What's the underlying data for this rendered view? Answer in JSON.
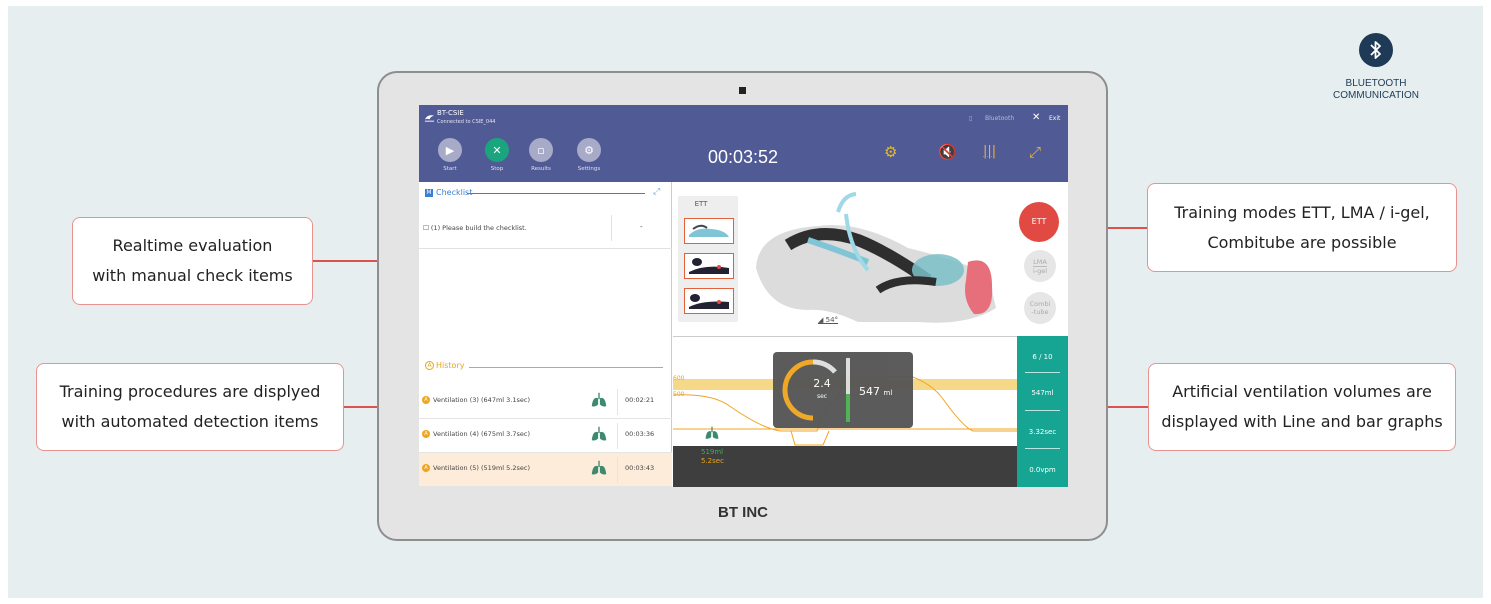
{
  "callouts": {
    "realtime": {
      "line1": "Realtime evaluation",
      "line2": "with manual check items"
    },
    "procedures": {
      "line1": "Training procedures are displyed",
      "line2": "with automated detection items"
    },
    "modes": {
      "line1": "Training modes ETT, LMA / i-gel,",
      "line2": "Combitube are possible"
    },
    "ventilation": {
      "line1": "Artificial ventilation volumes are",
      "line2": "displayed with Line and bar graphs"
    }
  },
  "bluetooth": {
    "icon": "bluetooth-icon",
    "line1": "BLUETOOTH",
    "line2": "COMMUNICATION"
  },
  "device": {
    "brand": "BT INC"
  },
  "app": {
    "title": "BT-CSIE",
    "subtitle": "Connected to CSIE_044",
    "bluetooth_label": "Bluetooth",
    "exit_label": "Exit",
    "timer": "00:03:52",
    "toolbar": [
      {
        "label": "Start",
        "icon": "play-icon"
      },
      {
        "label": "Stop",
        "icon": "close-icon"
      },
      {
        "label": "Results",
        "icon": "document-icon"
      },
      {
        "label": "Settings",
        "icon": "gear-icon"
      }
    ]
  },
  "checklist": {
    "title": "Checklist",
    "items": [
      {
        "text": "(1) Please build the checklist.",
        "value": "-"
      }
    ]
  },
  "history": {
    "title": "History",
    "items": [
      {
        "label": "Ventilation (3)",
        "detail": "(647ml 3.1sec)",
        "time": "00:02:21"
      },
      {
        "label": "Ventilation (4)",
        "detail": "(675ml 3.7sec)",
        "time": "00:03:36"
      },
      {
        "label": "Ventilation (5)",
        "detail": "(519ml 5.2sec)",
        "time": "00:03:43"
      }
    ]
  },
  "training": {
    "ett_panel_label": "ETT",
    "modes": {
      "ett": "ETT",
      "lma1": "LMA",
      "lma2": "i-gel",
      "combi1": "Combi",
      "combi2": "-tube"
    },
    "angle": "54°"
  },
  "graph": {
    "y_600": "600",
    "y_500": "500",
    "volume": "519ml",
    "duration": "5.2sec"
  },
  "overlay": {
    "seconds": "2.4",
    "sec_unit": "sec",
    "volume": "547",
    "volume_unit": "ml"
  },
  "stats": {
    "count": "6 / 10",
    "volume": "547ml",
    "time": "3.32sec",
    "rate": "0.0vpm"
  }
}
